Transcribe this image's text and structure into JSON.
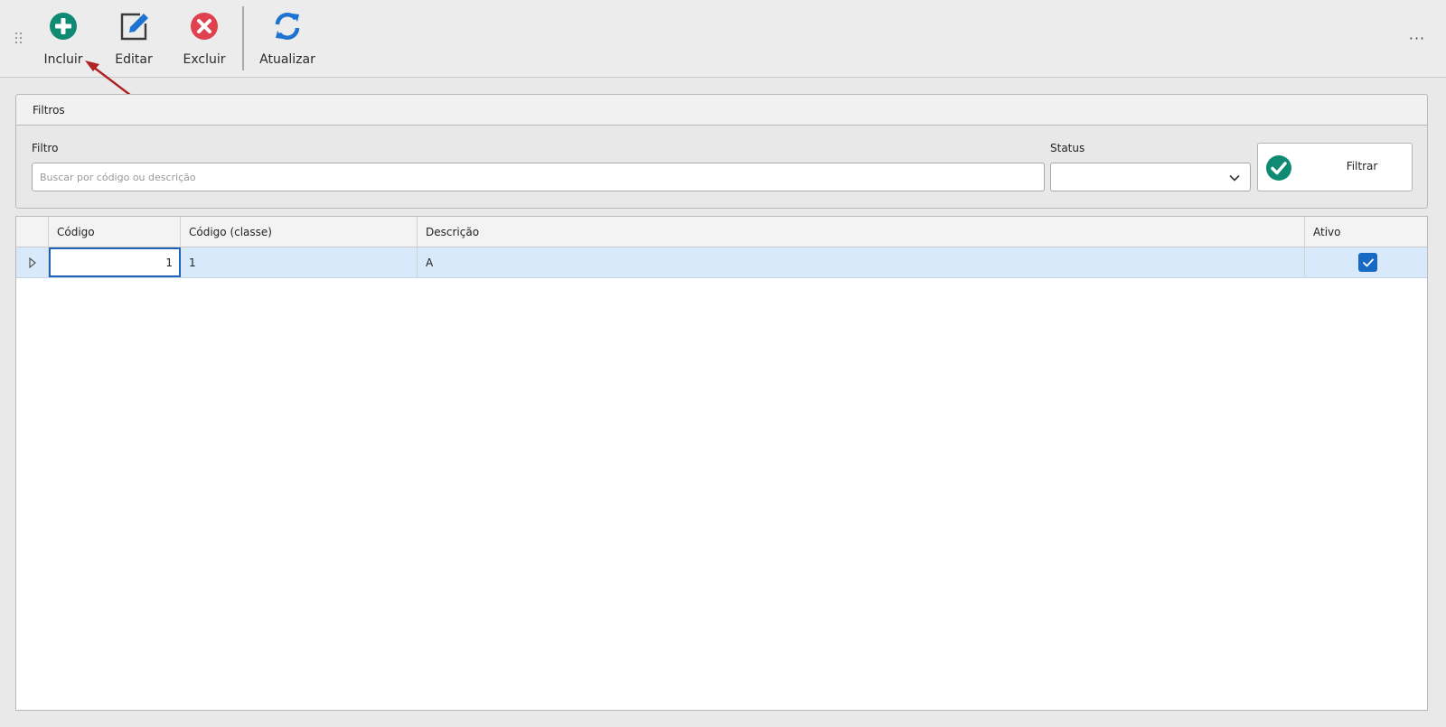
{
  "toolbar": {
    "buttons": [
      {
        "label": "Incluir",
        "icon": "plus-circle-icon",
        "color": "#0f8a73"
      },
      {
        "label": "Editar",
        "icon": "edit-icon",
        "color": "#1e73d2"
      },
      {
        "label": "Excluir",
        "icon": "close-circle-icon",
        "color": "#e0414f"
      },
      {
        "label": "Atualizar",
        "icon": "refresh-icon",
        "color": "#1e73d2"
      }
    ],
    "more_label": "···"
  },
  "filters": {
    "title": "Filtros",
    "filtro_label": "Filtro",
    "filtro_placeholder": "Buscar por código ou descrição",
    "filtro_value": "",
    "status_label": "Status",
    "status_value": "",
    "filter_button_label": "Filtrar"
  },
  "grid": {
    "columns": [
      "Código",
      "Código (classe)",
      "Descrição",
      "Ativo"
    ],
    "rows": [
      {
        "codigo": "1",
        "codigo_classe": "1",
        "descricao": "A",
        "ativo": true
      }
    ]
  },
  "colors": {
    "accent_green": "#0f8a73",
    "accent_blue": "#1769c4",
    "danger_red": "#e0414f",
    "selected_row": "#d7e9fa",
    "annotation_arrow": "#b22222"
  }
}
